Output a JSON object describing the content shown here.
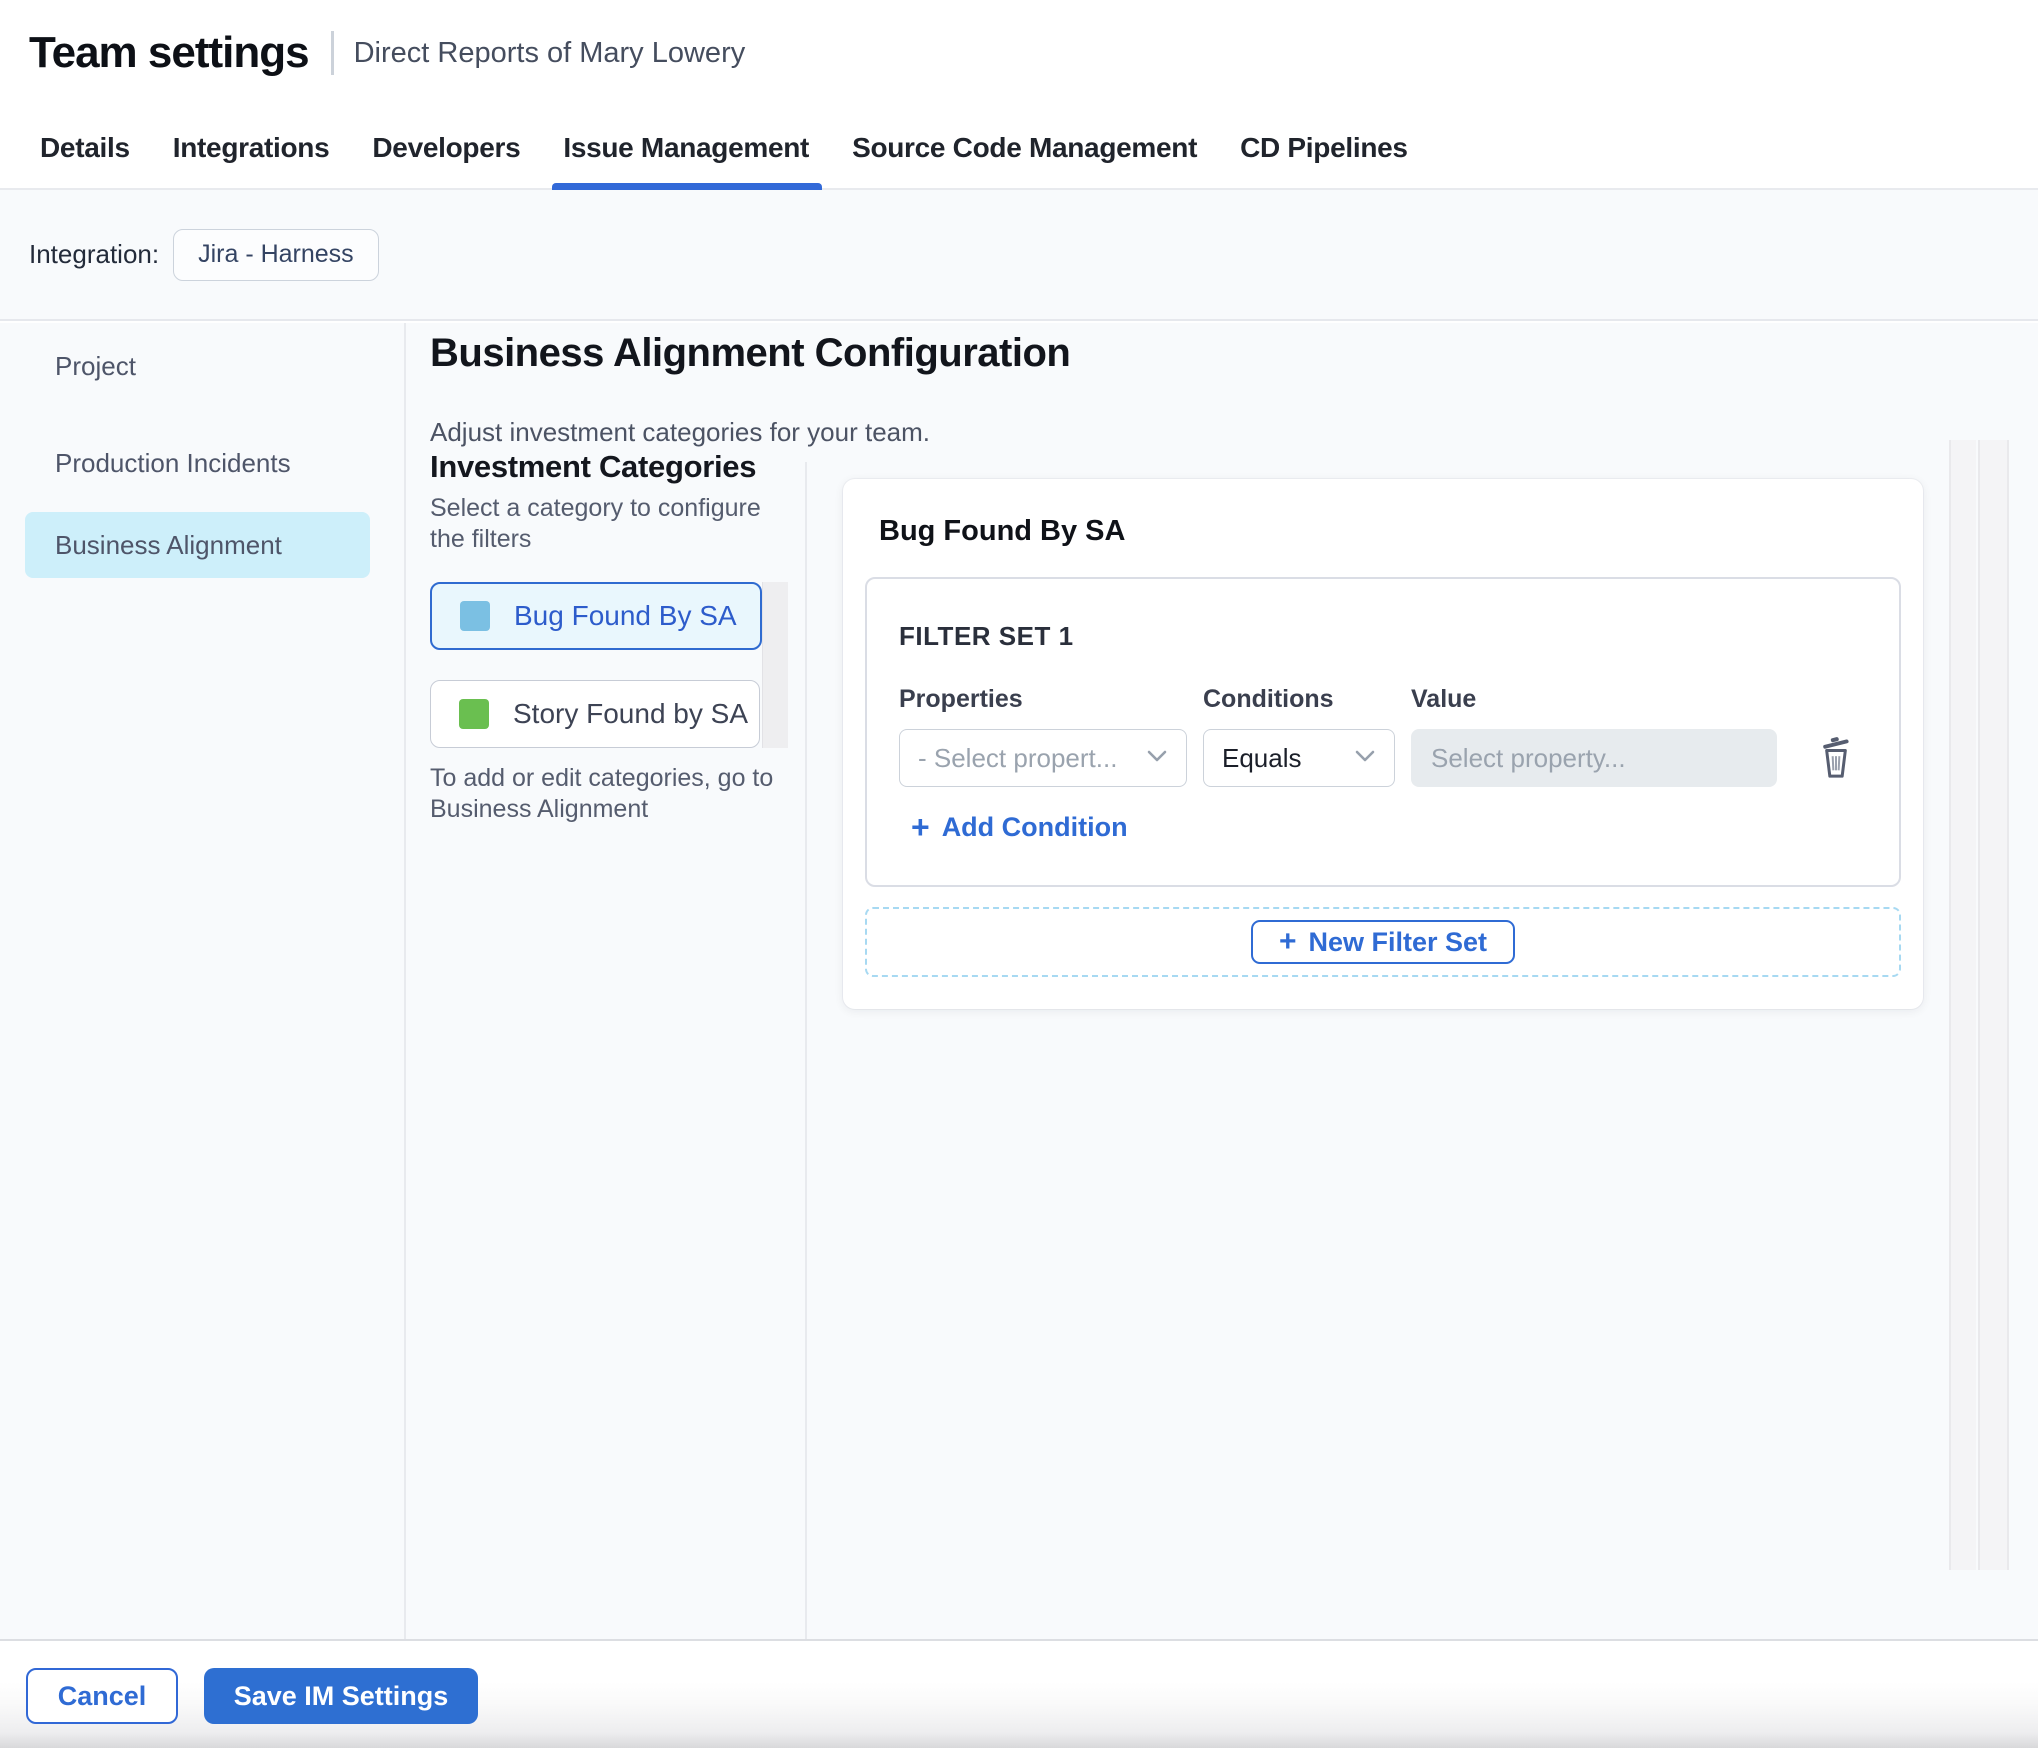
{
  "header": {
    "title": "Team settings",
    "subtitle": "Direct Reports of Mary Lowery"
  },
  "tabs": [
    {
      "label": "Details",
      "active": false
    },
    {
      "label": "Integrations",
      "active": false
    },
    {
      "label": "Developers",
      "active": false
    },
    {
      "label": "Issue Management",
      "active": true
    },
    {
      "label": "Source Code Management",
      "active": false
    },
    {
      "label": "CD Pipelines",
      "active": false
    }
  ],
  "integration_bar": {
    "label": "Integration:",
    "chip": "Jira - Harness"
  },
  "sidebar": {
    "items": [
      {
        "label": "Project",
        "selected": false
      },
      {
        "label": "Production Incidents",
        "selected": false
      },
      {
        "label": "Business Alignment",
        "selected": true
      }
    ]
  },
  "main": {
    "title": "Business Alignment Configuration",
    "subtitle": "Adjust investment categories for your team.",
    "categories_panel": {
      "heading": "Investment Categories",
      "caption": "Select a category to configure the filters",
      "categories": [
        {
          "label": "Bug Found By SA",
          "swatch_color": "#7bc0e3",
          "selected": true
        },
        {
          "label": "Story Found by SA",
          "swatch_color": "#6abf50",
          "selected": false
        }
      ],
      "footnote": "To add or edit categories, go to Business Alignment"
    },
    "config_panel": {
      "heading": "Bug Found By SA",
      "filter_set": {
        "title": "FILTER SET 1",
        "columns": [
          "Properties",
          "Conditions",
          "Value"
        ],
        "condition_row": {
          "property_placeholder": "- Select propert...",
          "condition_value": "Equals",
          "value_placeholder": "Select property...",
          "value_current": ""
        },
        "add_condition_label": "Add Condition"
      },
      "new_filter_set_label": "New Filter Set"
    }
  },
  "footer": {
    "cancel_label": "Cancel",
    "save_label": "Save IM Settings"
  },
  "icons": {
    "plus": "+"
  },
  "colors": {
    "primary_blue": "#2f6bd4",
    "tab_underline": "#3269d8",
    "selected_sidebar_bg": "#cdeffa",
    "selected_category_bg": "#e9f7fd",
    "bug_swatch": "#7bc0e3",
    "story_swatch": "#6abf50",
    "save_button_bg": "#2e6fd2",
    "dashed_border": "#a7d9f2",
    "content_bg": "#f8fafc"
  }
}
